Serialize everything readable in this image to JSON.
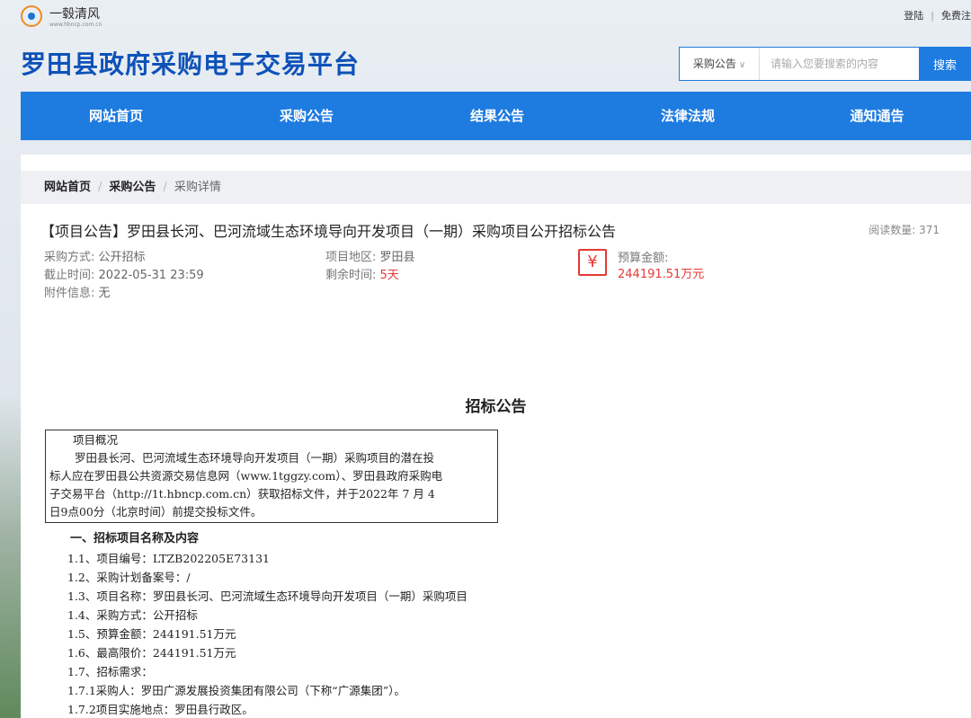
{
  "topbar": {
    "logo_text": "一毂清风",
    "logo_url": "www.hbncp.com.cn",
    "login": "登陆",
    "register": "免费注"
  },
  "site_title": "罗田县政府采购电子交易平台",
  "search": {
    "type_selected": "采购公告",
    "placeholder": "请输入您要搜索的内容",
    "button": "搜索"
  },
  "nav": [
    "网站首页",
    "采购公告",
    "结果公告",
    "法律法规",
    "通知通告"
  ],
  "breadcrumb": [
    "网站首页",
    "采购公告",
    "采购详情"
  ],
  "notice": {
    "title": "【项目公告】罗田县长河、巴河流域生态环境导向开发项目（一期）采购项目公开招标公告",
    "read_label": "阅读数量:",
    "read_count": "371",
    "method_label": "采购方式:",
    "method": "公开招标",
    "deadline_label": "截止时间:",
    "deadline": "2022-05-31 23:59",
    "attach_label": "附件信息:",
    "attach": "无",
    "region_label": "项目地区:",
    "region": "罗田县",
    "remain_label": "剩余时间:",
    "remain": "5天",
    "yen": "¥",
    "budget_label": "预算金额:",
    "budget": "244191.51万元"
  },
  "doc": {
    "title": "招标公告",
    "overview_head": "项目概况",
    "overview_lines": [
      "罗田县长河、巴河流域生态环境导向开发项目（一期）采购项目的潜在投",
      "标人应在罗田县公共资源交易信息网（www.1tggzy.com）、罗田县政府采购电",
      "子交易平台（http://1t.hbncp.com.cn）获取招标文件，并于2022年 7 月 4",
      "日9点00分（北京时间）前提交投标文件。"
    ],
    "section1": "一、招标项目名称及内容",
    "items": [
      "1.1、项目编号：LTZB202205E73131",
      "1.2、采购计划备案号：/",
      "1.3、项目名称：罗田县长河、巴河流域生态环境导向开发项目（一期）采购项目",
      "1.4、采购方式：公开招标",
      "1.5、预算金额：244191.51万元",
      "1.6、最高限价：244191.51万元",
      "1.7、招标需求：",
      "1.7.1采购人：罗田广源发展投资集团有限公司（下称“广源集团”）。",
      "1.7.2项目实施地点：罗田县行政区。"
    ]
  }
}
